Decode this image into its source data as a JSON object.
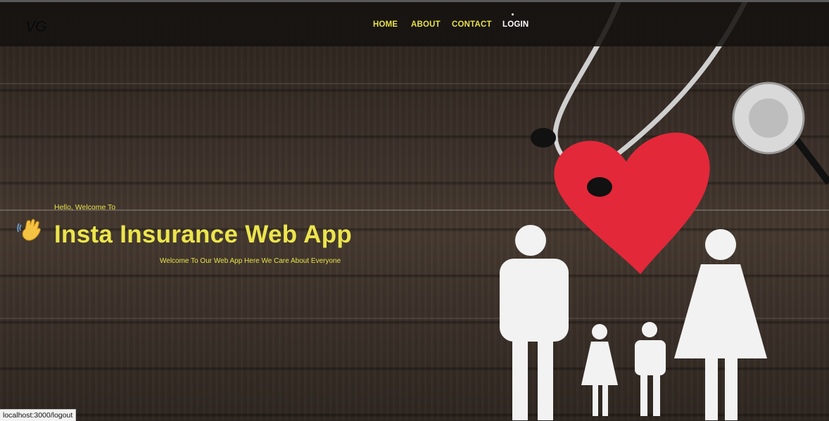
{
  "brand": {
    "logo_text": "VG"
  },
  "nav": {
    "items": [
      {
        "label": "HOME",
        "active": false
      },
      {
        "label": "ABOUT",
        "active": false
      },
      {
        "label": "CONTACT",
        "active": false
      },
      {
        "label": "LOGIN",
        "active": true
      }
    ]
  },
  "hero": {
    "greeting": "Hello, Welcome To",
    "title": "Insta Insurance Web App",
    "subtitle": "Welcome To Our Web App Here We Care About Everyone",
    "wave_icon": "waving-hand-icon"
  },
  "status_bar": {
    "url": "localhost:3000/logout"
  },
  "colors": {
    "accent": "#ece54c",
    "nav_bg": "#161210",
    "heart": "#e3283a",
    "figures": "#f2f2f2"
  }
}
